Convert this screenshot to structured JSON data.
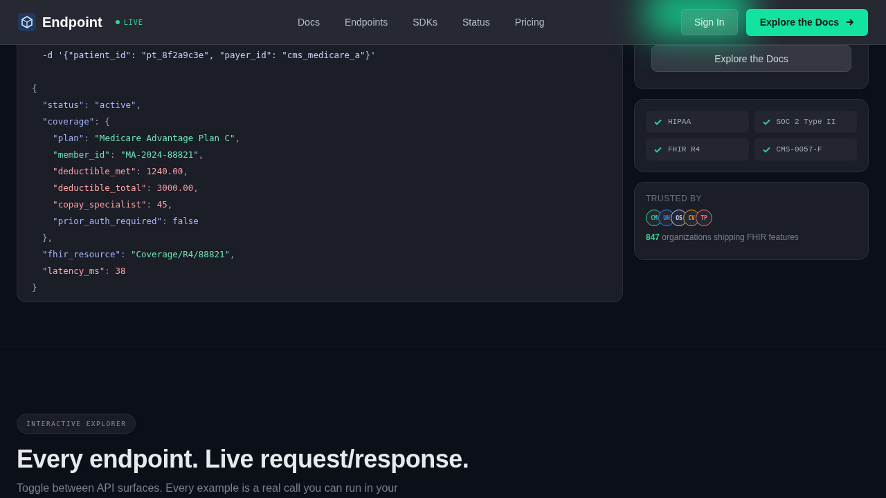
{
  "header": {
    "brand": "Endpoint",
    "live_badge": "LIVE",
    "nav": [
      "Docs",
      "Endpoints",
      "SDKs",
      "Status",
      "Pricing"
    ],
    "sign_in": "Sign In",
    "cta": "Explore the Docs"
  },
  "code": {
    "command": "  -d '{\"patient_id\": \"pt_8f2a9c3e\", \"payer_id\": \"cms_medicare_a\"}'",
    "lines": [
      [
        {
          "t": "{",
          "kind": "punct"
        }
      ],
      [
        {
          "t": "  \"status\"",
          "kind": "key"
        },
        {
          "t": ": ",
          "kind": "punct"
        },
        {
          "t": "\"active\"",
          "kind": "key"
        },
        {
          "t": ",",
          "kind": "punct"
        }
      ],
      [
        {
          "t": "  \"coverage\"",
          "kind": "key"
        },
        {
          "t": ": {",
          "kind": "punct"
        }
      ],
      [
        {
          "t": "    \"plan\"",
          "kind": "key"
        },
        {
          "t": ": ",
          "kind": "punct"
        },
        {
          "t": "\"Medicare Advantage Plan C\"",
          "kind": "string"
        },
        {
          "t": ",",
          "kind": "punct"
        }
      ],
      [
        {
          "t": "    \"member_id\"",
          "kind": "string"
        },
        {
          "t": ": ",
          "kind": "punct"
        },
        {
          "t": "\"MA-2024-88821\"",
          "kind": "string"
        },
        {
          "t": ",",
          "kind": "punct"
        }
      ],
      [
        {
          "t": "    \"deductible_met\"",
          "kind": "number"
        },
        {
          "t": ": ",
          "kind": "punct"
        },
        {
          "t": "1240.00",
          "kind": "number"
        },
        {
          "t": ",",
          "kind": "punct"
        }
      ],
      [
        {
          "t": "    \"deductible_total\"",
          "kind": "number"
        },
        {
          "t": ": ",
          "kind": "punct"
        },
        {
          "t": "3000.00",
          "kind": "number"
        },
        {
          "t": ",",
          "kind": "punct"
        }
      ],
      [
        {
          "t": "    \"copay_specialist\"",
          "kind": "number"
        },
        {
          "t": ": ",
          "kind": "punct"
        },
        {
          "t": "45",
          "kind": "number"
        },
        {
          "t": ",",
          "kind": "punct"
        }
      ],
      [
        {
          "t": "    \"prior_auth_required\"",
          "kind": "key"
        },
        {
          "t": ": ",
          "kind": "punct"
        },
        {
          "t": "false",
          "kind": "key"
        }
      ],
      [
        {
          "t": "  },",
          "kind": "punct"
        }
      ],
      [
        {
          "t": "  \"fhir_resource\"",
          "kind": "key"
        },
        {
          "t": ": ",
          "kind": "punct"
        },
        {
          "t": "\"Coverage/R4/88821\"",
          "kind": "string"
        },
        {
          "t": ",",
          "kind": "punct"
        }
      ],
      [
        {
          "t": "  \"latency_ms\"",
          "kind": "number"
        },
        {
          "t": ": ",
          "kind": "punct"
        },
        {
          "t": "38",
          "kind": "number"
        }
      ],
      [
        {
          "t": "}",
          "kind": "punct"
        }
      ]
    ]
  },
  "side": {
    "docs_button": "Explore the Docs",
    "compliance": [
      "HIPAA",
      "SOC 2 Type II",
      "FHIR R4",
      "CMS-0057-F"
    ],
    "trusted": {
      "label": "TRUSTED BY",
      "avatars": [
        {
          "t": "CM",
          "color": "#34d399"
        },
        {
          "t": "UH",
          "color": "#3b82f6"
        },
        {
          "t": "OS",
          "color": "#c7c9f5"
        },
        {
          "t": "CV",
          "color": "#f59e0b"
        },
        {
          "t": "TP",
          "color": "#f87171"
        }
      ],
      "count": "847",
      "text": "organizations shipping FHIR features"
    }
  },
  "explorer": {
    "eyebrow": "INTERACTIVE EXPLORER",
    "title": "Every endpoint. Live request/response.",
    "lead": "Toggle between API surfaces. Every example is a real call you can run in your"
  }
}
